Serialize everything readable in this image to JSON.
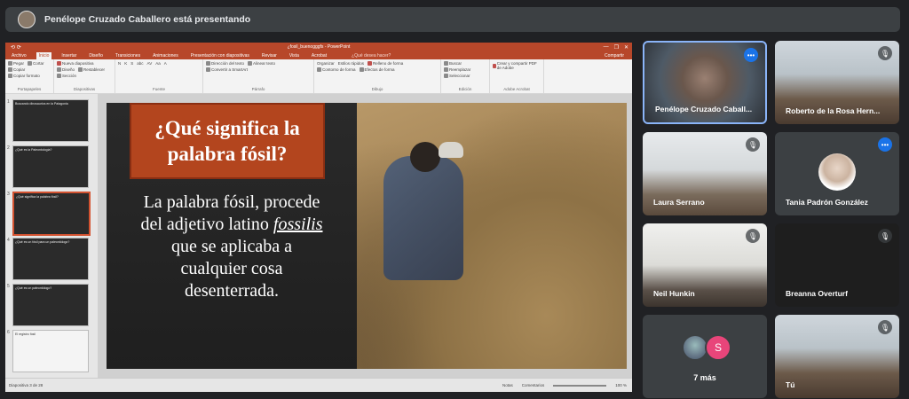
{
  "meet": {
    "presenting_text": "Penélope Cruzado Caballero está presentando"
  },
  "powerpoint": {
    "window_title": "¿fosil_buenogggfs - PowerPoint",
    "quick_access": "⟲ ⟳",
    "window_controls": [
      "—",
      "❐",
      "✕"
    ],
    "tabs": [
      "Archivo",
      "Inicio",
      "Insertar",
      "Diseño",
      "Transiciones",
      "Animaciones",
      "Presentación con diapositivas",
      "Revisar",
      "Vista",
      "Acrobat"
    ],
    "active_tab": "Inicio",
    "tell_me": "¿Qué desea hacer?",
    "share": "Compartir",
    "ribbon_groups": [
      {
        "label": "Portapapeles",
        "cmds": [
          "Pegar",
          "Cortar",
          "Copiar",
          "Copiar formato"
        ]
      },
      {
        "label": "Diapositivas",
        "cmds": [
          "Nueva diapositiva",
          "Diseño",
          "Restablecer",
          "Sección"
        ]
      },
      {
        "label": "Fuente",
        "cmds": [
          "N",
          "K",
          "S",
          "abc",
          "AV",
          "Aa",
          "A"
        ]
      },
      {
        "label": "Párrafo",
        "cmds": [
          "Dirección del texto",
          "Alinear texto",
          "Convertir a SmartArt"
        ]
      },
      {
        "label": "Dibujo",
        "cmds": [
          "Organizar",
          "Estilos rápidos",
          "Relleno de forma",
          "Contorno de forma",
          "Efectos de forma"
        ]
      },
      {
        "label": "Edición",
        "cmds": [
          "Buscar",
          "Reemplazar",
          "Seleccionar"
        ]
      },
      {
        "label": "Adobe Acrobat",
        "cmds": [
          "Crear y compartir PDF de Adobe"
        ]
      }
    ],
    "thumbnails": [
      {
        "num": "1",
        "title": "Buscando dinosaurios en la Patagonia"
      },
      {
        "num": "2",
        "title": "¿Qué es la Paleontología?"
      },
      {
        "num": "3",
        "title": "¿Qué significa la palabra fósil?"
      },
      {
        "num": "4",
        "title": "¿Qué es un fósil para un paleontólogo?"
      },
      {
        "num": "5",
        "title": "¿Qué es un paleontólogo?"
      },
      {
        "num": "6",
        "title": "El registro fósil"
      }
    ],
    "slide": {
      "title_line1": "¿Qué significa la",
      "title_line2": "palabra fósil?",
      "body_line1": "La palabra fósil, procede",
      "body_line2a": "del adjetivo latino ",
      "body_line2b": "fossilis",
      "body_line3": "que se aplicaba a",
      "body_line4": "cualquier cosa",
      "body_line5": "desenterrada."
    },
    "status": {
      "slide_info": "Diapositiva 3 de 28",
      "notes": "Notas",
      "comments": "Comentarios",
      "zoom": "100 %"
    }
  },
  "participants": [
    {
      "name": "Penélope Cruzado Caball...",
      "mic": "dots"
    },
    {
      "name": "Roberto de la Rosa Hern...",
      "mic": "muted"
    },
    {
      "name": "Laura Serrano",
      "mic": "muted"
    },
    {
      "name": "Tania Padrón González",
      "mic": "speaking"
    },
    {
      "name": "Neil Hunkin",
      "mic": "muted"
    },
    {
      "name": "Breanna Overturf",
      "mic": "muted"
    },
    {
      "name": "7 más",
      "initial": "S"
    },
    {
      "name": "Tú",
      "mic": "muted"
    }
  ],
  "icons": {
    "mic_muted": "mic-off-icon",
    "more": "more-dots-icon"
  },
  "colors": {
    "ppt_accent": "#b7472a",
    "meet_bg": "#202124",
    "meet_blue": "#1a73e8",
    "title_box": "#b3451e"
  }
}
